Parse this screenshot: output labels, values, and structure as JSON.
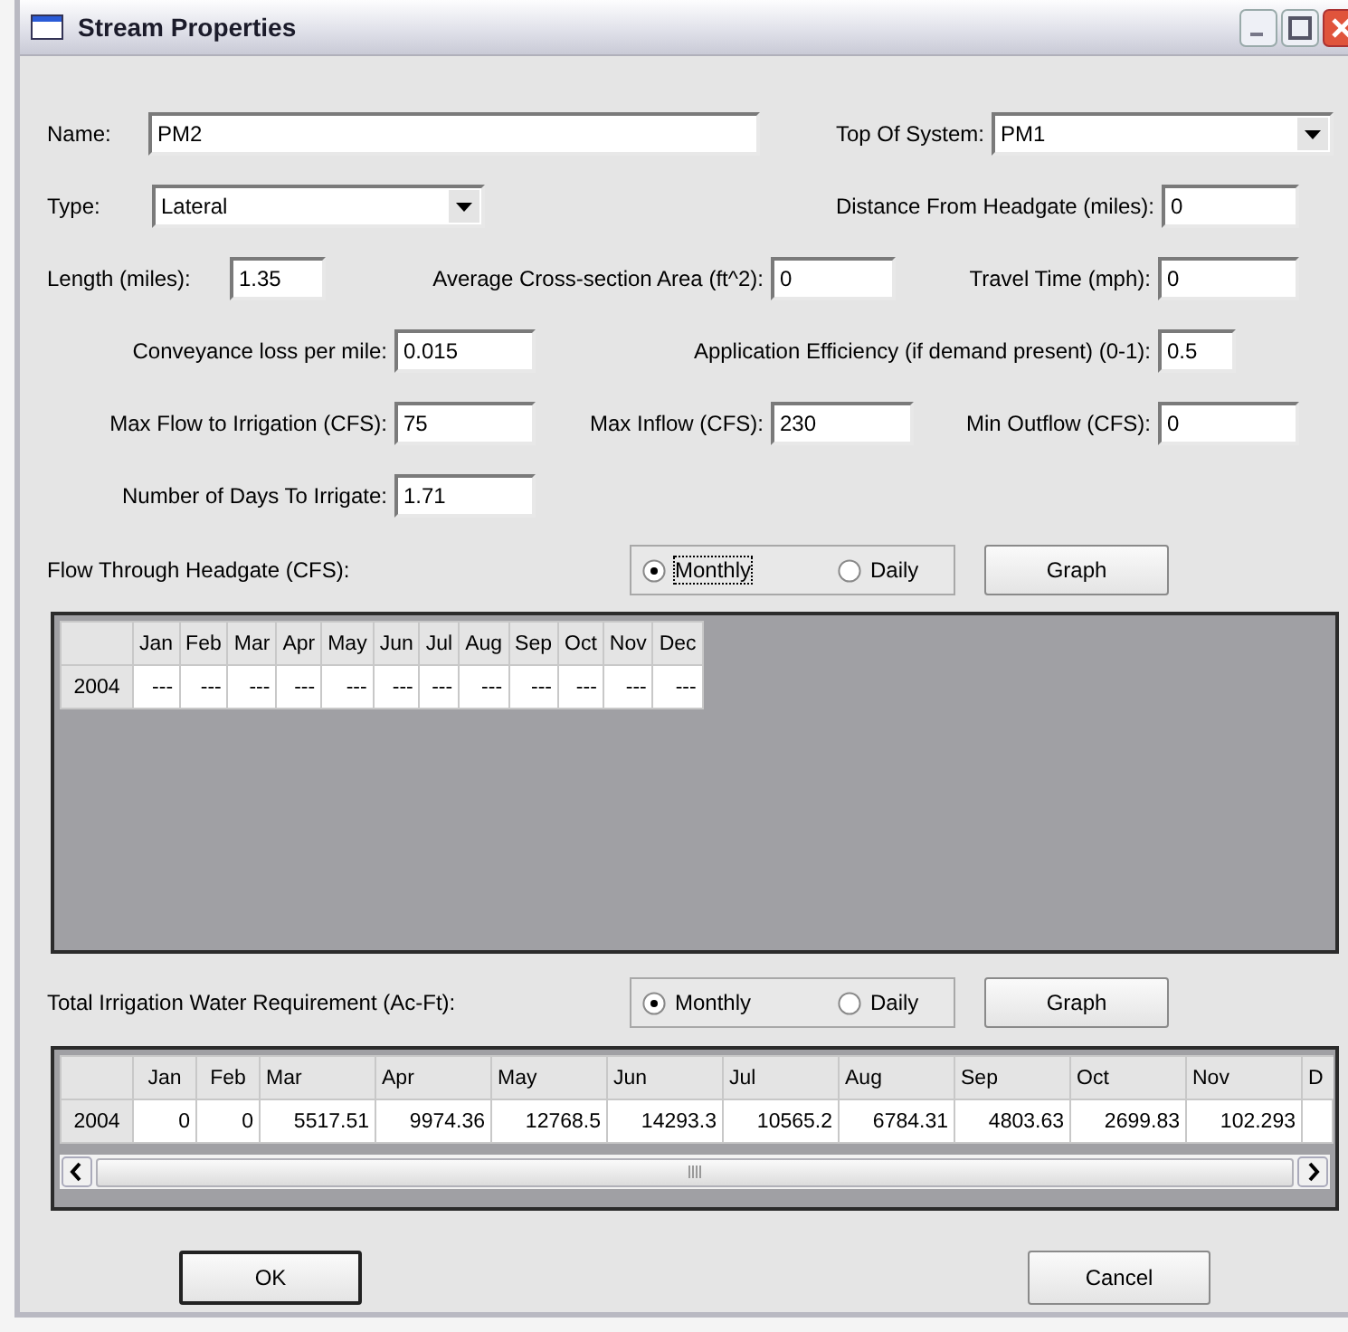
{
  "window": {
    "title": "Stream Properties"
  },
  "fields": {
    "name": {
      "label": "Name:",
      "value": "PM2"
    },
    "top_of_system": {
      "label": "Top Of System:",
      "value": "PM1"
    },
    "type": {
      "label": "Type:",
      "value": "Lateral"
    },
    "distance": {
      "label": "Distance From Headgate (miles):",
      "value": "0"
    },
    "length": {
      "label": "Length (miles):",
      "value": "1.35"
    },
    "area": {
      "label": "Average Cross-section Area (ft^2):",
      "value": "0"
    },
    "travel": {
      "label": "Travel Time (mph):",
      "value": "0"
    },
    "conveyance": {
      "label": "Conveyance loss per mile:",
      "value": "0.015"
    },
    "efficiency": {
      "label": "Application Efficiency (if demand present) (0-1):",
      "value": "0.5"
    },
    "max_flow": {
      "label": "Max Flow to Irrigation (CFS):",
      "value": "75"
    },
    "max_inflow": {
      "label": "Max Inflow (CFS):",
      "value": "230"
    },
    "min_outflow": {
      "label": "Min Outflow (CFS):",
      "value": "0"
    },
    "days": {
      "label": "Number of Days To Irrigate:",
      "value": "1.71"
    }
  },
  "sections": [
    {
      "label": "Flow Through Headgate (CFS):",
      "modes": [
        {
          "label": "Monthly",
          "selected": true,
          "focused": true
        },
        {
          "label": "Daily",
          "selected": false,
          "focused": false
        }
      ],
      "graph_button": "Graph",
      "table": {
        "columns": [
          "Jan",
          "Feb",
          "Mar",
          "Apr",
          "May",
          "Jun",
          "Jul",
          "Aug",
          "Sep",
          "Oct",
          "Nov",
          "Dec"
        ],
        "rows": [
          {
            "year": "2004",
            "cells": [
              "---",
              "---",
              "---",
              "---",
              "---",
              "---",
              "---",
              "---",
              "---",
              "---",
              "---",
              "---"
            ]
          }
        ]
      }
    },
    {
      "label": "Total Irrigation Water Requirement (Ac-Ft):",
      "modes": [
        {
          "label": "Monthly",
          "selected": true,
          "focused": false
        },
        {
          "label": "Daily",
          "selected": false,
          "focused": false
        }
      ],
      "graph_button": "Graph",
      "table": {
        "columns": [
          "Jan",
          "Feb",
          "Mar",
          "Apr",
          "May",
          "Jun",
          "Jul",
          "Aug",
          "Sep",
          "Oct",
          "Nov",
          "D"
        ],
        "rows": [
          {
            "year": "2004",
            "cells": [
              "0",
              "0",
              "5517.51",
              "9974.36",
              "12768.5",
              "14293.3",
              "10565.2",
              "6784.31",
              "4803.63",
              "2699.83",
              "102.293"
            ]
          }
        ]
      }
    }
  ],
  "buttons": [
    {
      "label": "OK",
      "default": true
    },
    {
      "label": "Cancel",
      "default": false
    }
  ]
}
